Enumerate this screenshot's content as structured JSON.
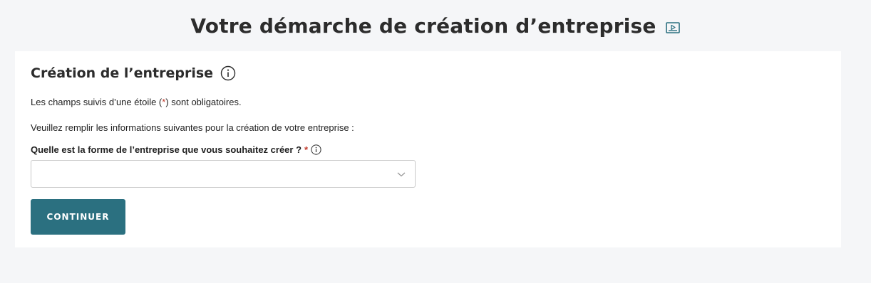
{
  "header": {
    "title": "Votre démarche de création d’entreprise",
    "video_icon": "video-play-icon"
  },
  "section": {
    "title": "Création de l’entreprise",
    "info_icon": "info-icon"
  },
  "required_note": {
    "before": "Les champs suivis d’une étoile (",
    "star": "*",
    "after": ") sont obligatoires."
  },
  "intro": "Veuillez remplir les informations suivantes pour la création de votre entreprise :",
  "form": {
    "field_label": "Quelle est la forme de l’entreprise que vous souhaitez créer ?",
    "required_star": "*",
    "select_value": "",
    "chevron_icon": "chevron-down-icon"
  },
  "actions": {
    "continue_label": "CONTINUER"
  },
  "colors": {
    "page_background": "#f5f6f8",
    "card_background": "#ffffff",
    "button_background": "#2b7080",
    "required_star": "#c0392b"
  }
}
